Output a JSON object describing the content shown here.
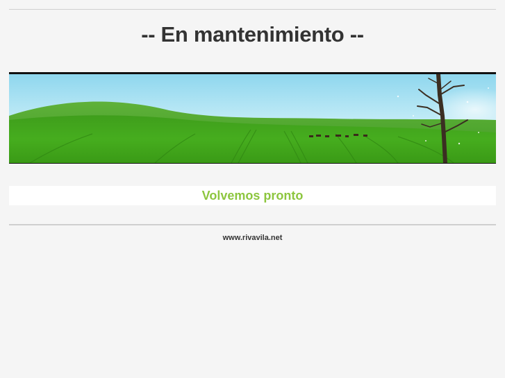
{
  "page": {
    "title": "-- En mantenimiento --",
    "message": "Volvemos pronto",
    "footer_link": "www.rivavila.net"
  },
  "banner": {
    "image": "green-meadow-landscape-with-tree"
  },
  "colors": {
    "background": "#f5f5f5",
    "title": "#333333",
    "message": "#8dc63f",
    "rule": "#cfcfcf"
  }
}
